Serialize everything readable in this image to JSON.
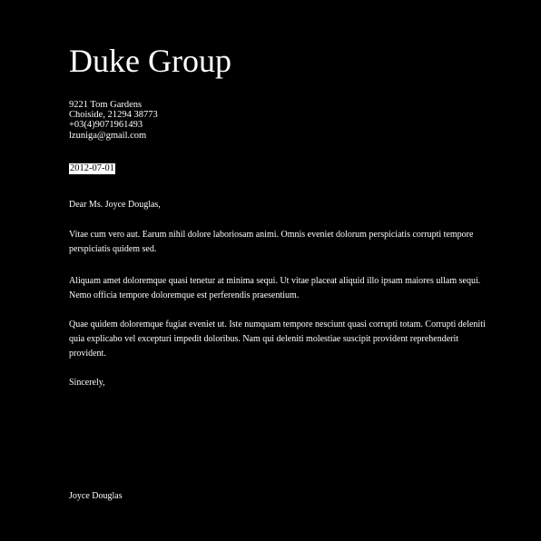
{
  "letter": {
    "company": "Duke Group",
    "address": [
      "9221 Tom Gardens",
      "Choiside, 21294 38773",
      "+03(4)9071961493",
      "lzuniga@gmail.com"
    ],
    "date": "2012-07-01",
    "salutation": "Dear Ms. Joyce Douglas,",
    "paragraphs": [
      "Vitae cum vero aut. Earum nihil dolore laboriosam animi. Omnis eveniet dolorum perspiciatis corrupti tempore perspiciatis quidem sed.",
      "Aliquam amet doloremque quasi tenetur at minima sequi. Ut vitae placeat aliquid illo ipsam maiores ullam sequi. Nemo officia tempore doloremque est perferendis praesentium.",
      "Quae quidem doloremque fugiat eveniet ut. Iste numquam tempore nesciunt quasi corrupti totam. Corrupti deleniti quia explicabo vel excepturi impedit doloribus. Nam qui deleniti molestiae suscipit provident reprehenderit provident."
    ],
    "closing": "Sincerely,",
    "signature": "Joyce Douglas"
  }
}
